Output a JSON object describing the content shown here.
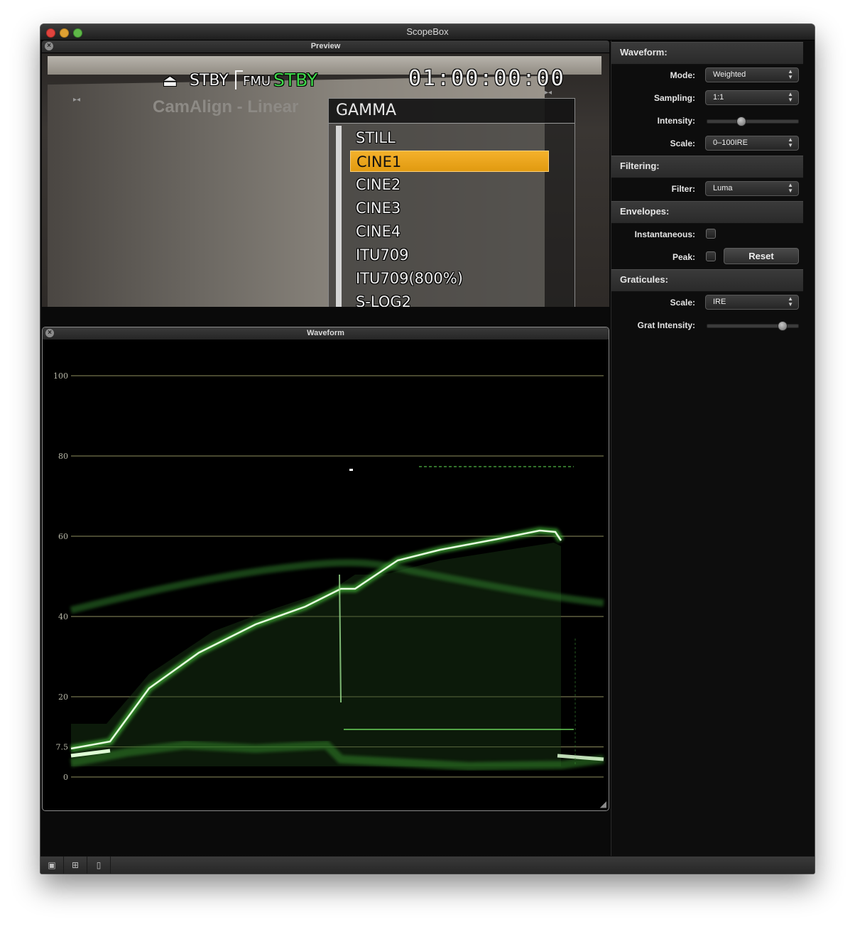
{
  "window": {
    "title": "ScopeBox"
  },
  "preview": {
    "title": "Preview",
    "osd": {
      "stby_left": "STBY",
      "fmu": "FMU",
      "stby_right": "STBY",
      "timecode": "01:00:00:00"
    },
    "chart_title": "CamAlign - Linear",
    "gamma_menu": {
      "title": "GAMMA",
      "items": [
        "STILL",
        "CINE1",
        "CINE2",
        "CINE3",
        "CINE4",
        "ITU709",
        "ITU709(800%)",
        "S-LOG2"
      ],
      "selected": "CINE1"
    }
  },
  "waveform": {
    "title": "Waveform",
    "graticule_labels": [
      "100",
      "80",
      "60",
      "40",
      "20",
      "7.5",
      "0"
    ],
    "graticule_values": [
      100,
      80,
      60,
      40,
      20,
      7.5,
      0
    ],
    "graticule_color": "#b5b57a",
    "trace_color": "#58c24a"
  },
  "inspector": {
    "waveform": {
      "heading": "Waveform:",
      "mode_label": "Mode:",
      "mode_value": "Weighted",
      "sampling_label": "Sampling:",
      "sampling_value": "1:1",
      "intensity_label": "Intensity:",
      "intensity_level": 0.35,
      "scale_label": "Scale:",
      "scale_value": "0–100IRE"
    },
    "filtering": {
      "heading": "Filtering:",
      "filter_label": "Filter:",
      "filter_value": "Luma"
    },
    "envelopes": {
      "heading": "Envelopes:",
      "instantaneous_label": "Instantaneous:",
      "instantaneous_checked": false,
      "peak_label": "Peak:",
      "peak_checked": false,
      "reset_label": "Reset"
    },
    "graticules": {
      "heading": "Graticules:",
      "scale_label": "Scale:",
      "scale_value": "IRE",
      "grat_intensity_label": "Grat Intensity:",
      "grat_intensity_level": 0.85
    }
  },
  "bottombar": {
    "icons": [
      "image-icon",
      "grid-icon",
      "document-icon"
    ]
  }
}
